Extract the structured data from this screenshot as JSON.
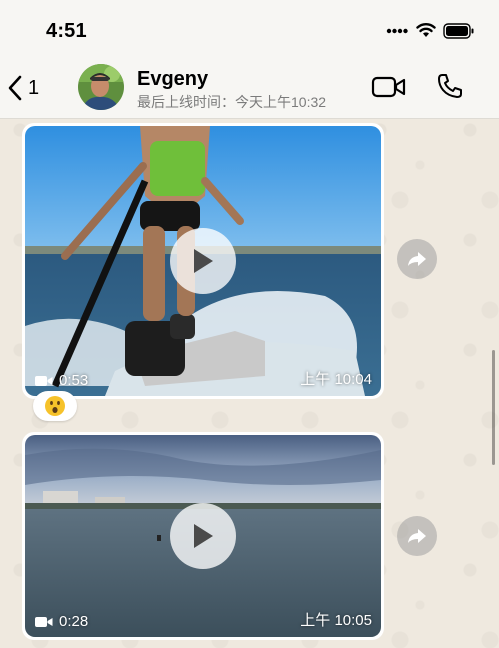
{
  "status_bar": {
    "time": "4:51"
  },
  "header": {
    "back_count": "1",
    "contact_name": "Evgeny",
    "last_seen": "最后上线时间：今天上午10:32"
  },
  "messages": [
    {
      "type": "video",
      "duration": "0:53",
      "timestamp": "上午 10:04",
      "reaction": "😮"
    },
    {
      "type": "video",
      "duration": "0:28",
      "timestamp": "上午 10:05"
    }
  ],
  "icons": {
    "back": "chevron-left-icon",
    "video_call": "video-camera-icon",
    "voice_call": "phone-icon",
    "play": "play-icon",
    "forward": "forward-arrow-icon",
    "video_indicator": "video-camera-icon",
    "signal": "cellular-signal-icon",
    "wifi": "wifi-icon",
    "battery": "battery-icon"
  },
  "colors": {
    "chat_background": "#efe9df",
    "header_background": "#f7f6f3",
    "bubble": "#ffffff",
    "secondary_text": "#7b7b7b"
  }
}
